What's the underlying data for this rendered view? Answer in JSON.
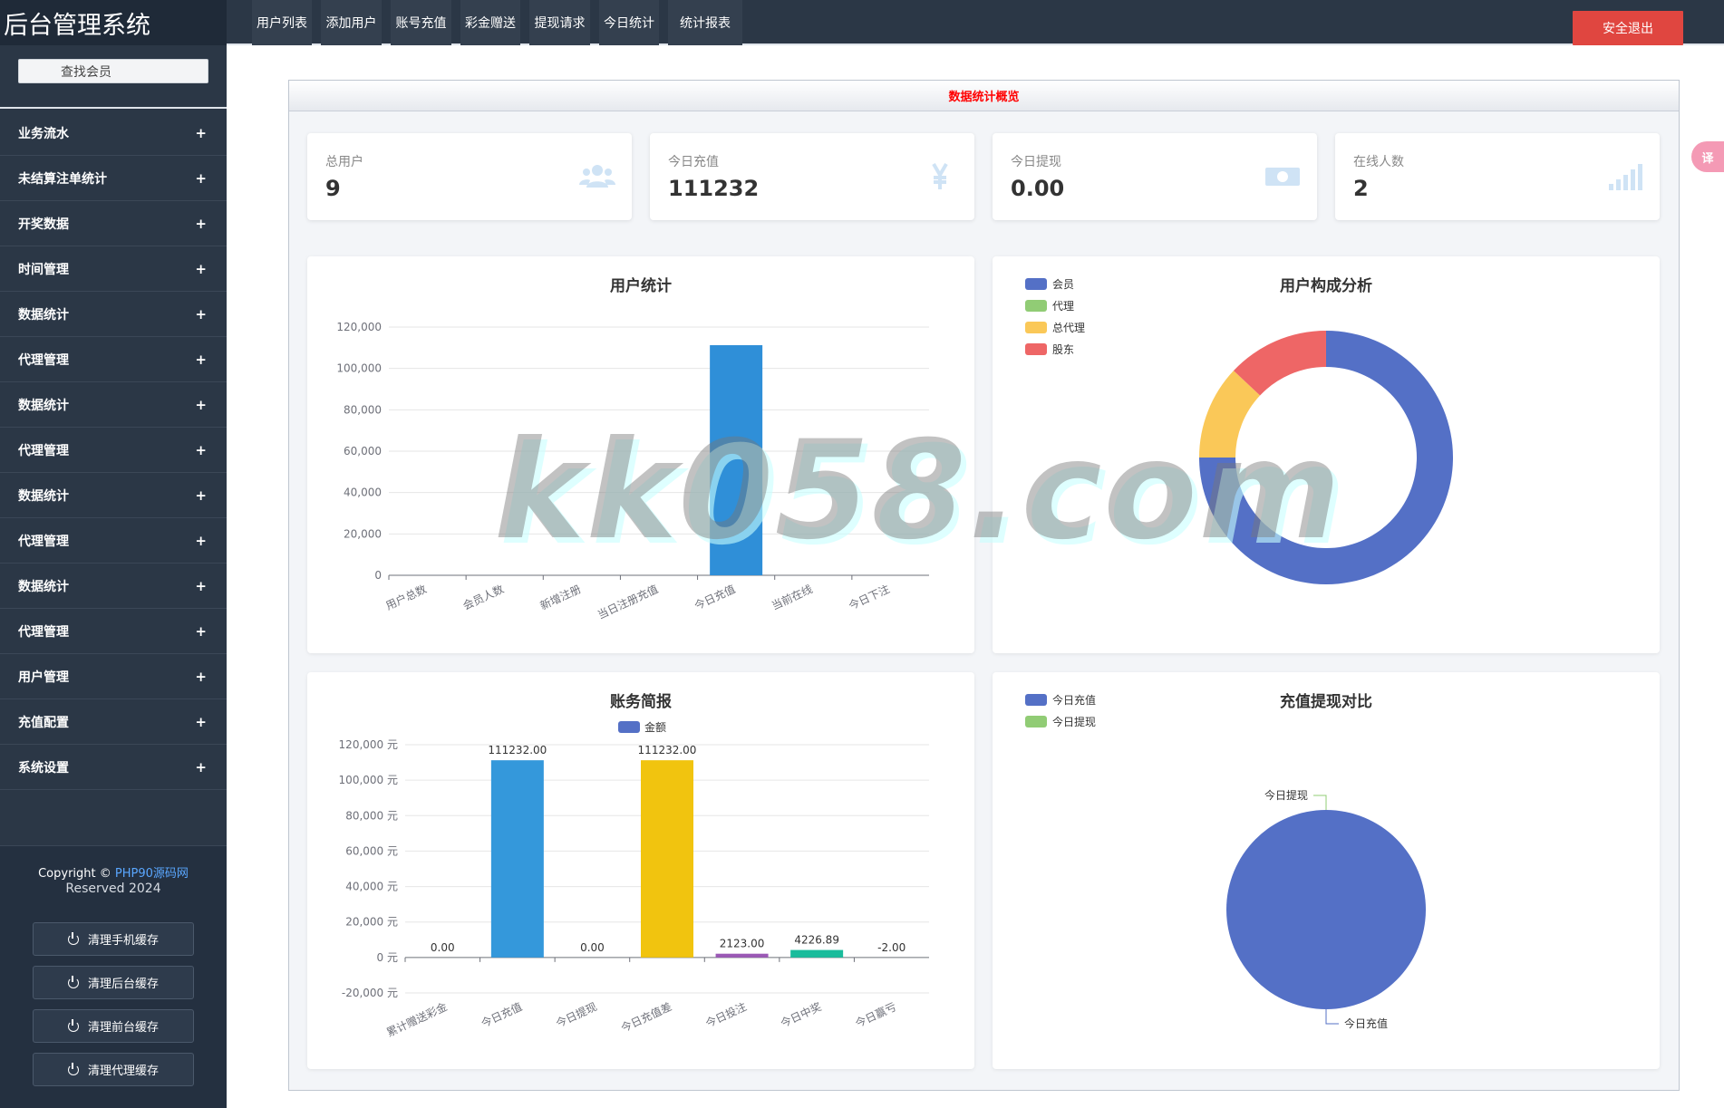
{
  "app": {
    "title": "后台管理系统"
  },
  "sidebar": {
    "search_label": "查找会员",
    "items": [
      {
        "label": "业务流水"
      },
      {
        "label": "未结算注单统计"
      },
      {
        "label": "开奖数据"
      },
      {
        "label": "时间管理"
      },
      {
        "label": "数据统计"
      },
      {
        "label": "代理管理"
      },
      {
        "label": "数据统计"
      },
      {
        "label": "代理管理"
      },
      {
        "label": "数据统计"
      },
      {
        "label": "代理管理"
      },
      {
        "label": "数据统计"
      },
      {
        "label": "代理管理"
      },
      {
        "label": "用户管理"
      },
      {
        "label": "充值配置"
      },
      {
        "label": "系统设置"
      }
    ],
    "expand_symbol": "+",
    "footer": {
      "copyright": "Copyright ©",
      "link_text": "PHP90源码网",
      "reserved": "Reserved 2024",
      "buttons": [
        {
          "label": "清理手机缓存"
        },
        {
          "label": "清理后台缓存"
        },
        {
          "label": "清理前台缓存"
        },
        {
          "label": "清理代理缓存"
        }
      ]
    }
  },
  "topbar": {
    "tabs": [
      {
        "label": "用户列表"
      },
      {
        "label": "添加用户"
      },
      {
        "label": "账号充值"
      },
      {
        "label": "彩金赠送"
      },
      {
        "label": "提现请求"
      },
      {
        "label": "今日统计"
      },
      {
        "label": "统计报表"
      }
    ],
    "logout_label": "安全退出",
    "translate_badge": "译"
  },
  "panel": {
    "title": "数据统计概览"
  },
  "stats": [
    {
      "label": "总用户",
      "value": "9",
      "icon": "users-icon"
    },
    {
      "label": "今日充值",
      "value": "111232",
      "icon": "yen-icon"
    },
    {
      "label": "今日提现",
      "value": "0.00",
      "icon": "money-bill-icon"
    },
    {
      "label": "在线人数",
      "value": "2",
      "icon": "signal-bars-icon"
    }
  ],
  "watermark": "kk058.com",
  "chart_data": [
    {
      "type": "bar",
      "title": "用户统计",
      "categories": [
        "用户总数",
        "会员人数",
        "新增注册",
        "当日注册充值",
        "今日充值",
        "当前在线",
        "今日下注"
      ],
      "values": [
        9,
        9,
        0,
        0,
        111232,
        2,
        0
      ],
      "ylim": [
        0,
        120000
      ],
      "yticks": [
        "0",
        "20,000",
        "40,000",
        "60,000",
        "80,000",
        "100,000",
        "120,000"
      ],
      "color": "#2f8fd8"
    },
    {
      "type": "pie",
      "title": "用户构成分析",
      "legend": [
        {
          "name": "会员",
          "color": "#5470c6",
          "value": 75
        },
        {
          "name": "代理",
          "color": "#91cc75",
          "value": 0
        },
        {
          "name": "总代理",
          "color": "#fac858",
          "value": 12
        },
        {
          "name": "股东",
          "color": "#ee6666",
          "value": 13
        }
      ]
    },
    {
      "type": "bar",
      "title": "账务简报",
      "legend": "金额",
      "categories": [
        "累计赠送彩金",
        "今日充值",
        "今日提现",
        "今日充值差",
        "今日投注",
        "今日中奖",
        "今日赢亏"
      ],
      "values": [
        0,
        111232,
        0,
        111232,
        2123,
        4226.89,
        -2
      ],
      "labels": [
        "0.00",
        "111232.00",
        "0.00",
        "111232.00",
        "2123.00",
        "4226.89",
        "-2.00"
      ],
      "colors": [
        "#5470c6",
        "#3498db",
        "#5470c6",
        "#f1c40f",
        "#9b59b6",
        "#1abc9c",
        "#e74c3c"
      ],
      "ylim": [
        -20000,
        120000
      ],
      "yticks": [
        "-20,000 元",
        "0 元",
        "20,000 元",
        "40,000 元",
        "60,000 元",
        "80,000 元",
        "100,000 元",
        "120,000 元"
      ]
    },
    {
      "type": "pie",
      "title": "充值提现对比",
      "legend": [
        {
          "name": "今日充值",
          "color": "#5470c6",
          "value": 111232
        },
        {
          "name": "今日提现",
          "color": "#91cc75",
          "value": 0
        }
      ]
    }
  ]
}
